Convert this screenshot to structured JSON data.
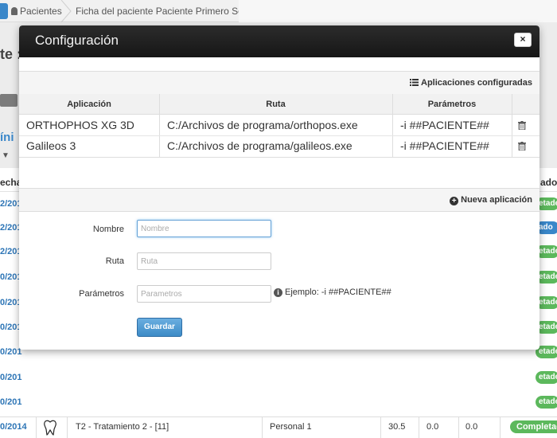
{
  "breadcrumb": {
    "items": [
      "Pacientes",
      "Ficha del paciente Paciente Primero Segundo"
    ]
  },
  "background": {
    "title_fragment": "te :",
    "link_fragment": "íni",
    "col_fecha": "echa",
    "col_estado": "ado",
    "dates": [
      "2/201",
      "2/201",
      "2/201",
      "0/201",
      "0/201",
      "0/201",
      "0/201",
      "0/201",
      "0/201"
    ],
    "status_pills": [
      "etade",
      "ado",
      "etade",
      "etade",
      "etade",
      "etade",
      "etade",
      "etade",
      "etade",
      "etade"
    ],
    "last_row": {
      "date": "0/2014",
      "treatment": "T2 - Tratamiento 2 - [11]",
      "professional": "Personal 1",
      "v1": "30.5",
      "v2": "0.0",
      "v3": "0.0",
      "status": "Completado"
    }
  },
  "modal": {
    "title": "Configuración",
    "close_label": "×",
    "configured_apps_label": "Aplicaciones configuradas",
    "table": {
      "headers": [
        "Aplicación",
        "Ruta",
        "Parámetros"
      ],
      "rows": [
        {
          "app": "ORTHOPHOS XG 3D",
          "path": "C:/Archivos de programa/orthopos.exe",
          "params": "-i ##PACIENTE##"
        },
        {
          "app": "Galileos 3",
          "path": "C:/Archivos de programa/galileos.exe",
          "params": "-i ##PACIENTE##"
        }
      ]
    },
    "new_app_label": "Nueva aplicación",
    "form": {
      "name_label": "Nombre",
      "name_placeholder": "Nombre",
      "path_label": "Ruta",
      "path_placeholder": "Ruta",
      "params_label": "Parámetros",
      "params_placeholder": "Parametros",
      "hint": "Ejemplo: -i ##PACIENTE##",
      "save_label": "Guardar"
    }
  },
  "colors": {
    "accent": "#3a87c9",
    "success": "#5cb85c",
    "header_dark": "#1f1f1f"
  }
}
